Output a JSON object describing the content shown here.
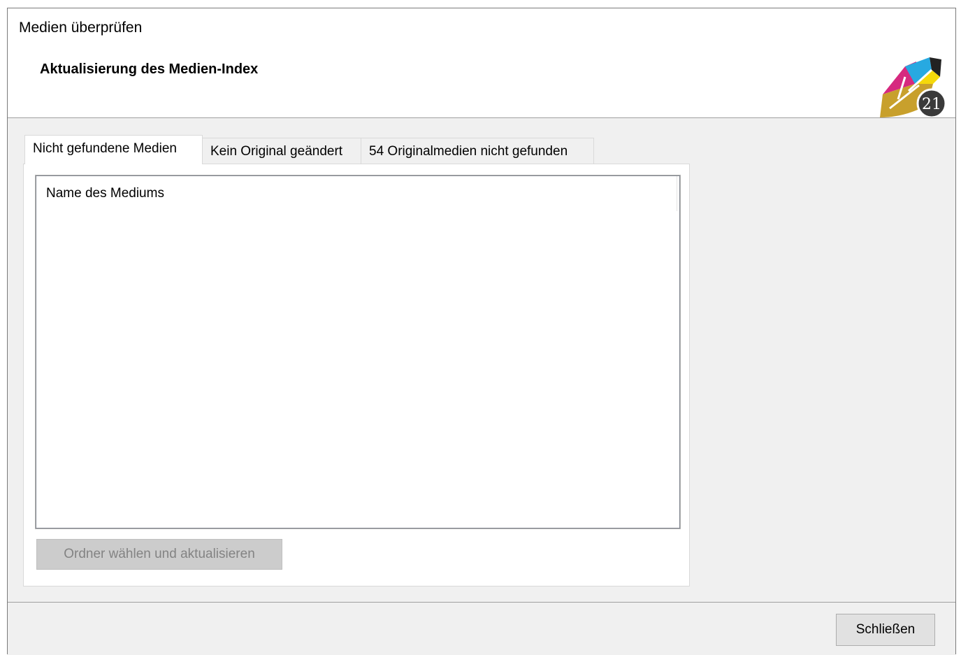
{
  "window": {
    "title": "Medien überprüfen"
  },
  "header": {
    "title": "Aktualisierung des Medien-Index",
    "logo_icon": "app-logo-21-icon"
  },
  "tabs": [
    {
      "label": "Nicht gefundene Medien",
      "active": true
    },
    {
      "label": "Kein Original geändert",
      "active": false
    },
    {
      "label": "54 Originalmedien nicht gefunden",
      "active": false
    }
  ],
  "list": {
    "columns": [
      "Name des Mediums"
    ],
    "rows": []
  },
  "actions": {
    "choose_folder_label": "Ordner wählen und aktualisieren",
    "choose_folder_enabled": false,
    "close_label": "Schließen"
  },
  "colors": {
    "panel_bg": "#f0f0f0",
    "button_disabled_bg": "#cccccc",
    "logo_gold": "#c8a02c",
    "logo_magenta": "#d6297f"
  }
}
